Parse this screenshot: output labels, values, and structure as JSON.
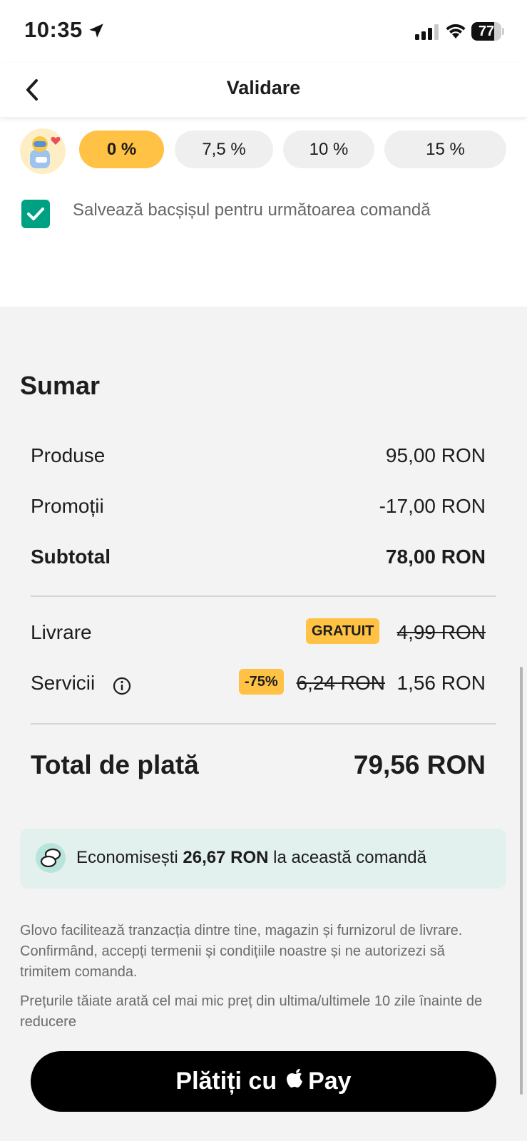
{
  "status_bar": {
    "time": "10:35",
    "battery": "77",
    "battery_level": 0.77
  },
  "header": {
    "title": "Validare",
    "back_icon": "chevron-left-icon"
  },
  "tip": {
    "options": [
      "0 %",
      "7,5 %",
      "10 %",
      "15 %"
    ],
    "selected_index": 0,
    "save_tip_label": "Salvează bacșișul pentru următoarea comandă",
    "save_tip_checked": true
  },
  "summary": {
    "title": "Sumar",
    "products_label": "Produse",
    "products_value": "95,00 RON",
    "promotions_label": "Promoții",
    "promotions_value": "-17,00 RON",
    "subtotal_label": "Subtotal",
    "subtotal_value": "78,00 RON",
    "delivery_label": "Livrare",
    "delivery_badge": "GRATUIT",
    "delivery_old_price": "4,99 RON",
    "services_label": "Servicii",
    "services_badge": "-75%",
    "services_old_price": "6,24 RON",
    "services_value": "1,56 RON",
    "total_label": "Total de plată",
    "total_value": "79,56 RON"
  },
  "savings": {
    "prefix": "Economisești",
    "amount": "26,67 RON",
    "suffix": "la această comandă"
  },
  "legal": {
    "terms": "Glovo facilitează tranzacția dintre tine, magazin și furnizorul de livrare. Confirmând, accepți termenii și condițiile noastre și ne autorizezi să trimitem comanda.",
    "price_note": "Prețurile tăiate arată cel mai mic preț din ultima/ultimele 10 zile înainte de reducere"
  },
  "pay_button": {
    "prefix": "Plătiți cu",
    "suffix": "Pay"
  },
  "colors": {
    "accent_yellow": "#ffc244",
    "checkbox_green": "#00a082",
    "savings_bg": "#e2f0ee"
  }
}
